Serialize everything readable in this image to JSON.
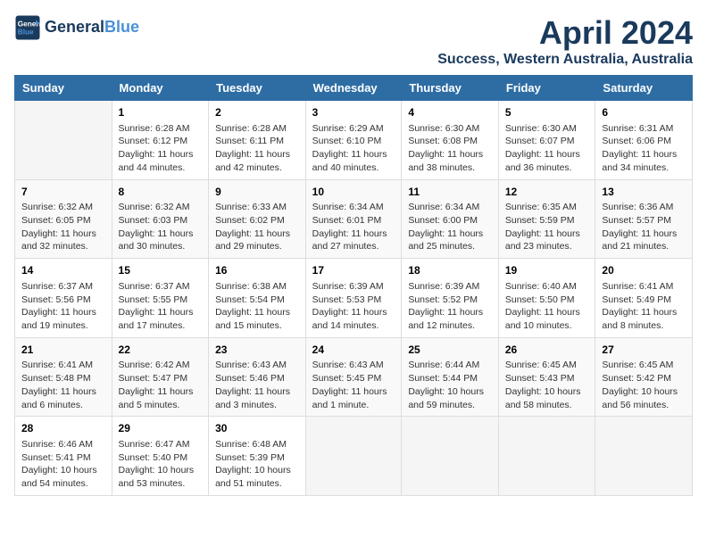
{
  "header": {
    "logo_line1": "General",
    "logo_line2": "Blue",
    "title": "April 2024",
    "subtitle": "Success, Western Australia, Australia"
  },
  "days_of_week": [
    "Sunday",
    "Monday",
    "Tuesday",
    "Wednesday",
    "Thursday",
    "Friday",
    "Saturday"
  ],
  "weeks": [
    [
      {
        "day": "",
        "info": ""
      },
      {
        "day": "1",
        "info": "Sunrise: 6:28 AM\nSunset: 6:12 PM\nDaylight: 11 hours\nand 44 minutes."
      },
      {
        "day": "2",
        "info": "Sunrise: 6:28 AM\nSunset: 6:11 PM\nDaylight: 11 hours\nand 42 minutes."
      },
      {
        "day": "3",
        "info": "Sunrise: 6:29 AM\nSunset: 6:10 PM\nDaylight: 11 hours\nand 40 minutes."
      },
      {
        "day": "4",
        "info": "Sunrise: 6:30 AM\nSunset: 6:08 PM\nDaylight: 11 hours\nand 38 minutes."
      },
      {
        "day": "5",
        "info": "Sunrise: 6:30 AM\nSunset: 6:07 PM\nDaylight: 11 hours\nand 36 minutes."
      },
      {
        "day": "6",
        "info": "Sunrise: 6:31 AM\nSunset: 6:06 PM\nDaylight: 11 hours\nand 34 minutes."
      }
    ],
    [
      {
        "day": "7",
        "info": "Sunrise: 6:32 AM\nSunset: 6:05 PM\nDaylight: 11 hours\nand 32 minutes."
      },
      {
        "day": "8",
        "info": "Sunrise: 6:32 AM\nSunset: 6:03 PM\nDaylight: 11 hours\nand 30 minutes."
      },
      {
        "day": "9",
        "info": "Sunrise: 6:33 AM\nSunset: 6:02 PM\nDaylight: 11 hours\nand 29 minutes."
      },
      {
        "day": "10",
        "info": "Sunrise: 6:34 AM\nSunset: 6:01 PM\nDaylight: 11 hours\nand 27 minutes."
      },
      {
        "day": "11",
        "info": "Sunrise: 6:34 AM\nSunset: 6:00 PM\nDaylight: 11 hours\nand 25 minutes."
      },
      {
        "day": "12",
        "info": "Sunrise: 6:35 AM\nSunset: 5:59 PM\nDaylight: 11 hours\nand 23 minutes."
      },
      {
        "day": "13",
        "info": "Sunrise: 6:36 AM\nSunset: 5:57 PM\nDaylight: 11 hours\nand 21 minutes."
      }
    ],
    [
      {
        "day": "14",
        "info": "Sunrise: 6:37 AM\nSunset: 5:56 PM\nDaylight: 11 hours\nand 19 minutes."
      },
      {
        "day": "15",
        "info": "Sunrise: 6:37 AM\nSunset: 5:55 PM\nDaylight: 11 hours\nand 17 minutes."
      },
      {
        "day": "16",
        "info": "Sunrise: 6:38 AM\nSunset: 5:54 PM\nDaylight: 11 hours\nand 15 minutes."
      },
      {
        "day": "17",
        "info": "Sunrise: 6:39 AM\nSunset: 5:53 PM\nDaylight: 11 hours\nand 14 minutes."
      },
      {
        "day": "18",
        "info": "Sunrise: 6:39 AM\nSunset: 5:52 PM\nDaylight: 11 hours\nand 12 minutes."
      },
      {
        "day": "19",
        "info": "Sunrise: 6:40 AM\nSunset: 5:50 PM\nDaylight: 11 hours\nand 10 minutes."
      },
      {
        "day": "20",
        "info": "Sunrise: 6:41 AM\nSunset: 5:49 PM\nDaylight: 11 hours\nand 8 minutes."
      }
    ],
    [
      {
        "day": "21",
        "info": "Sunrise: 6:41 AM\nSunset: 5:48 PM\nDaylight: 11 hours\nand 6 minutes."
      },
      {
        "day": "22",
        "info": "Sunrise: 6:42 AM\nSunset: 5:47 PM\nDaylight: 11 hours\nand 5 minutes."
      },
      {
        "day": "23",
        "info": "Sunrise: 6:43 AM\nSunset: 5:46 PM\nDaylight: 11 hours\nand 3 minutes."
      },
      {
        "day": "24",
        "info": "Sunrise: 6:43 AM\nSunset: 5:45 PM\nDaylight: 11 hours\nand 1 minute."
      },
      {
        "day": "25",
        "info": "Sunrise: 6:44 AM\nSunset: 5:44 PM\nDaylight: 10 hours\nand 59 minutes."
      },
      {
        "day": "26",
        "info": "Sunrise: 6:45 AM\nSunset: 5:43 PM\nDaylight: 10 hours\nand 58 minutes."
      },
      {
        "day": "27",
        "info": "Sunrise: 6:45 AM\nSunset: 5:42 PM\nDaylight: 10 hours\nand 56 minutes."
      }
    ],
    [
      {
        "day": "28",
        "info": "Sunrise: 6:46 AM\nSunset: 5:41 PM\nDaylight: 10 hours\nand 54 minutes."
      },
      {
        "day": "29",
        "info": "Sunrise: 6:47 AM\nSunset: 5:40 PM\nDaylight: 10 hours\nand 53 minutes."
      },
      {
        "day": "30",
        "info": "Sunrise: 6:48 AM\nSunset: 5:39 PM\nDaylight: 10 hours\nand 51 minutes."
      },
      {
        "day": "",
        "info": ""
      },
      {
        "day": "",
        "info": ""
      },
      {
        "day": "",
        "info": ""
      },
      {
        "day": "",
        "info": ""
      }
    ]
  ]
}
